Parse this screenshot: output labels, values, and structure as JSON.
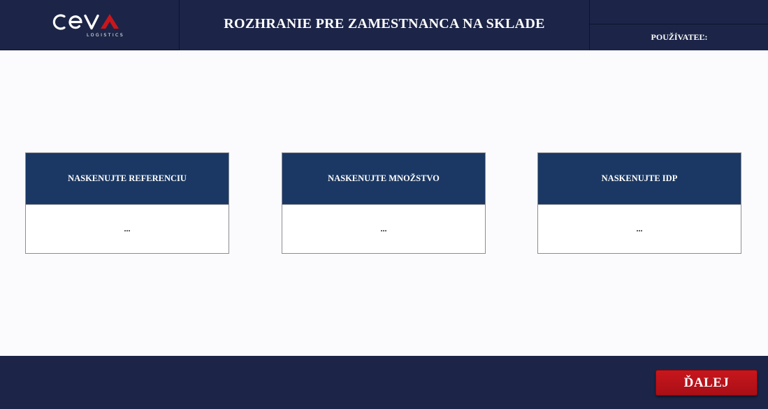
{
  "brand": {
    "logo_text": "CEVA",
    "logo_subtext": "LOGISTICS",
    "logo_icon": "ceva-logo-icon",
    "accent_color": "#c8161d"
  },
  "header": {
    "title": "ROZHRANIE PRE ZAMESTNANCA NA SKLADE",
    "user_label": "POUŽÍVATEĽ:",
    "user_value": ""
  },
  "cards": [
    {
      "label": "NASKENUJTE REFERENCIU",
      "value": "..."
    },
    {
      "label": "NASKENUJTE MNOŽSTVO",
      "value": "..."
    },
    {
      "label": "NASKENUJTE IDP",
      "value": "..."
    }
  ],
  "footer": {
    "next_label": "ĎALEJ"
  },
  "colors": {
    "header_bg": "#1c2547",
    "card_header_bg": "#1b3864",
    "button_bg": "#c8161d",
    "page_bg": "#fbfbfd"
  }
}
